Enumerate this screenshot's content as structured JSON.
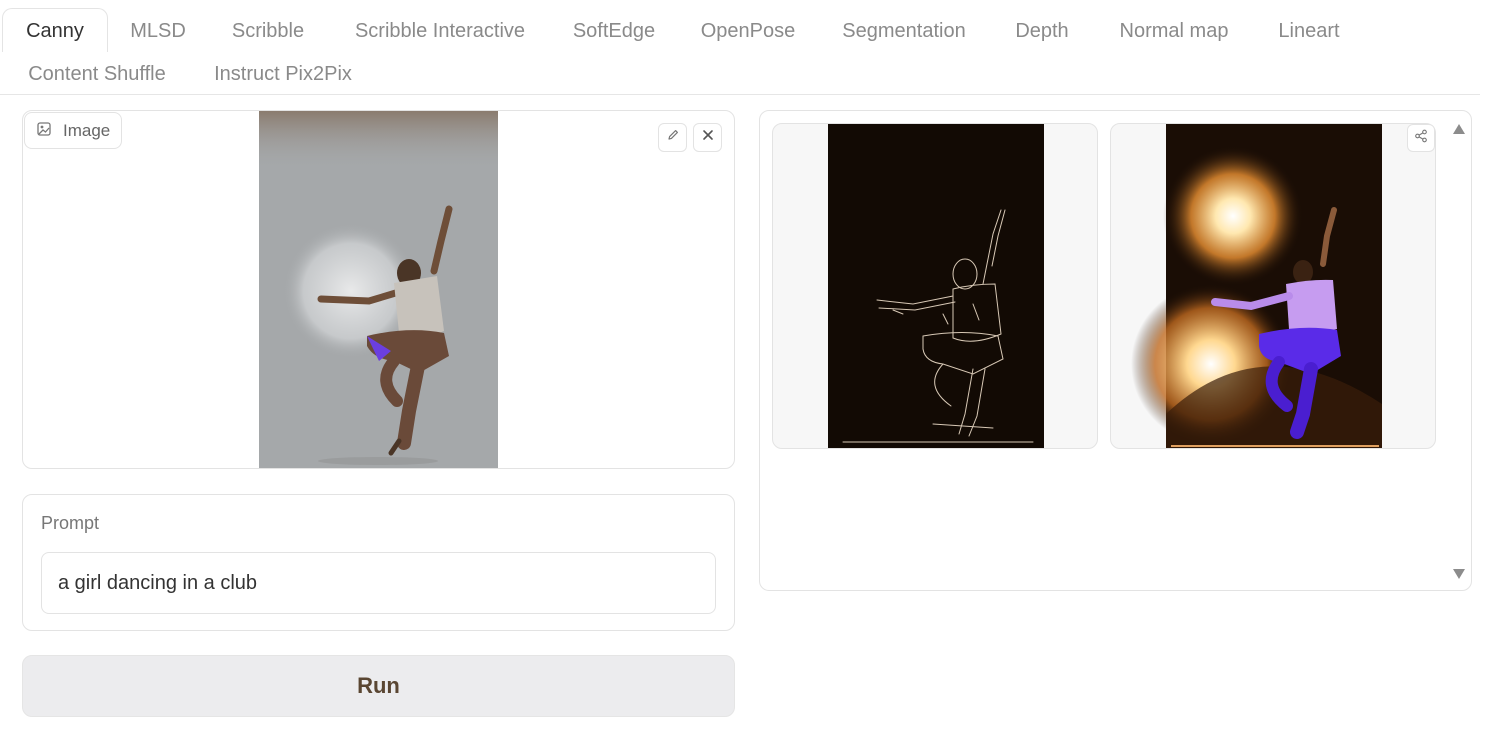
{
  "tabs": [
    {
      "label": "Canny",
      "active": true
    },
    {
      "label": "MLSD"
    },
    {
      "label": "Scribble"
    },
    {
      "label": "Scribble Interactive"
    },
    {
      "label": "SoftEdge"
    },
    {
      "label": "OpenPose"
    },
    {
      "label": "Segmentation"
    },
    {
      "label": "Depth"
    },
    {
      "label": "Normal map"
    },
    {
      "label": "Lineart"
    },
    {
      "label": "Content Shuffle"
    },
    {
      "label": "Instruct Pix2Pix"
    }
  ],
  "input_image": {
    "label": "Image",
    "label_icon": "image-icon",
    "edit_icon": "pencil-icon",
    "clear_icon": "close-icon"
  },
  "prompt": {
    "label": "Prompt",
    "value": "a girl dancing in a club"
  },
  "run": {
    "label": "Run"
  },
  "gallery": {
    "share_icon": "share-icon",
    "scroll_up_icon": "triangle-up-icon",
    "scroll_down_icon": "triangle-down-icon"
  },
  "colors": {
    "run_text": "#5a4632",
    "generated_purple": "#5a2be8",
    "generated_orange": "#e08a30"
  }
}
